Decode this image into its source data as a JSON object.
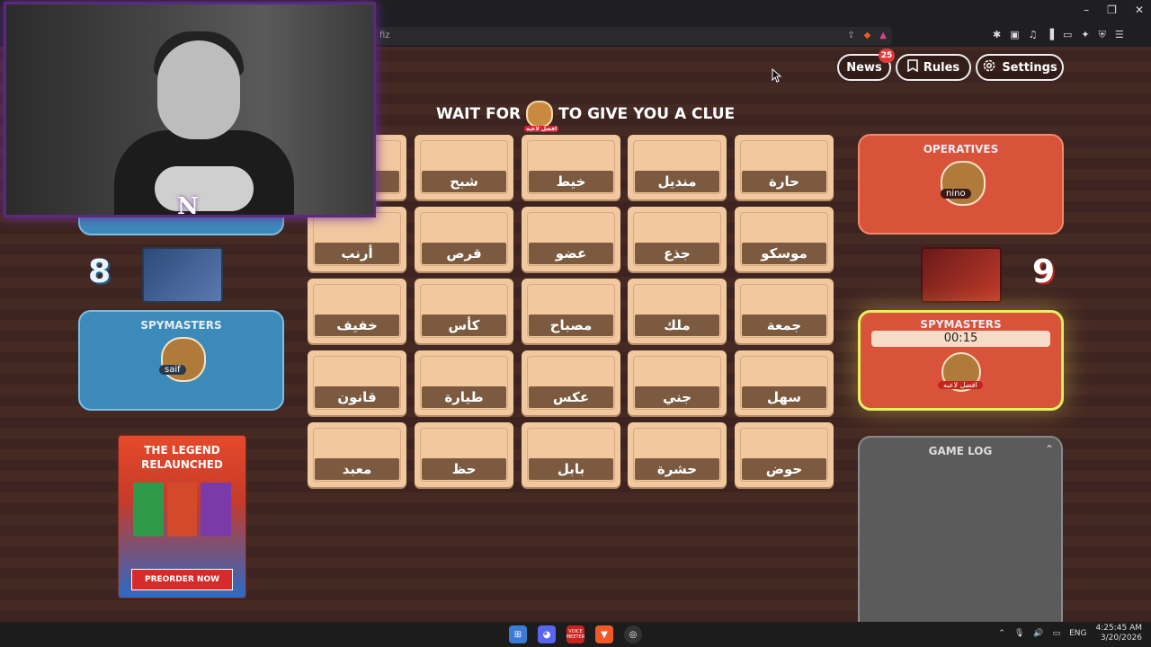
{
  "browser": {
    "address_text": "fiz",
    "window_controls": [
      "–",
      "❐",
      "✕"
    ]
  },
  "header": {
    "news": {
      "label": "News",
      "badge": "25"
    },
    "rules": {
      "label": "Rules"
    },
    "settings": {
      "label": "Settings"
    }
  },
  "clue_banner": {
    "before": "WAIT FOR",
    "after": "TO GIVE YOU A CLUE",
    "avatar_tag": "افضل لاعبه"
  },
  "board": {
    "rows": [
      [
        "",
        "شبح",
        "خيط",
        "منديل",
        "حارة"
      ],
      [
        "أرنب",
        "قرص",
        "عضو",
        "جذع",
        "موسكو"
      ],
      [
        "خفيف",
        "كأس",
        "مصباح",
        "ملك",
        "جمعة"
      ],
      [
        "قانون",
        "طيارة",
        "عكس",
        "جني",
        "سهل"
      ],
      [
        "معبد",
        "حظ",
        "بابل",
        "حشرة",
        "حوض"
      ]
    ]
  },
  "blue_team": {
    "score": "8",
    "spymasters_title": "SPYMASTERS",
    "spymaster_name": "saif"
  },
  "red_team": {
    "score": "9",
    "operatives_title": "OPERATIVES",
    "operative_name": "nino",
    "spymasters_title": "SPYMASTERS",
    "timer": "00:15",
    "spymaster_tag": "افضل لاعبه"
  },
  "game_log": {
    "title": "GAME LOG"
  },
  "promo": {
    "line1": "THE LEGEND",
    "line2": "RELAUNCHED",
    "button": "PREORDER NOW"
  },
  "webcam": {
    "logo": "N"
  },
  "taskbar": {
    "voicemeeter_label": "VOICE MEETER",
    "language": "ENG",
    "time": "4:25:45 AM",
    "date": "3/20/2026"
  },
  "colors": {
    "blue_panel": "#3c8ab9",
    "red_panel": "#d9523a",
    "card": "#f1c8a0",
    "card_label": "#7b5a3f",
    "timer_glow": "#e8f060"
  }
}
